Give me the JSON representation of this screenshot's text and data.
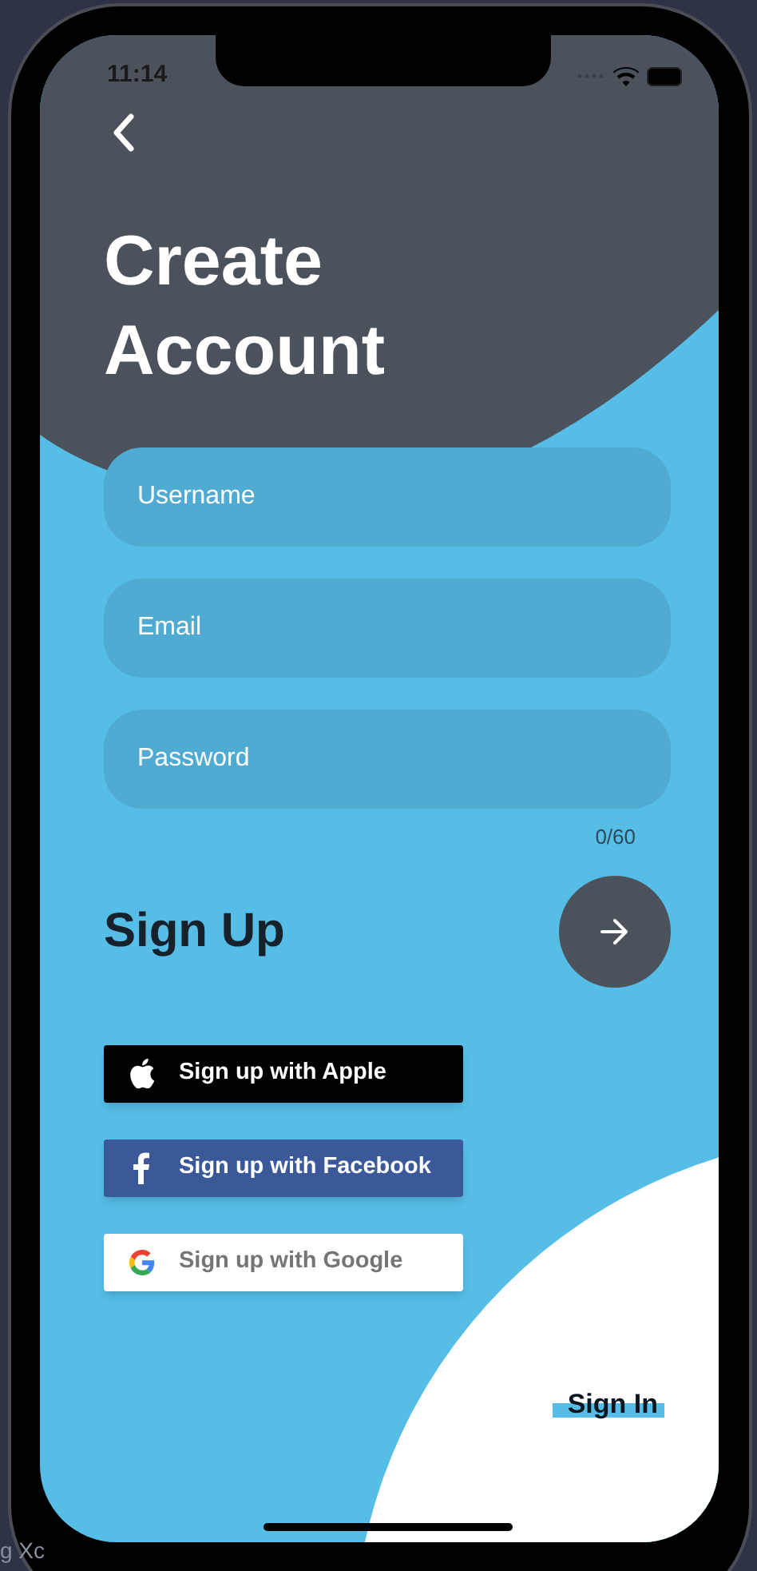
{
  "status_bar": {
    "time": "11:14"
  },
  "title": "Create Account",
  "fields": [
    {
      "placeholder": "Username"
    },
    {
      "placeholder": "Email"
    },
    {
      "placeholder": "Password"
    }
  ],
  "password_counter": "0/60",
  "heading": "Sign Up",
  "social_buttons": [
    {
      "kind": "apple",
      "label": "Sign up with Apple"
    },
    {
      "kind": "facebook",
      "label": "Sign up with Facebook"
    },
    {
      "kind": "google",
      "label": "Sign up with Google"
    }
  ],
  "sign_in_link": "Sign In",
  "background_text": "g Xc"
}
